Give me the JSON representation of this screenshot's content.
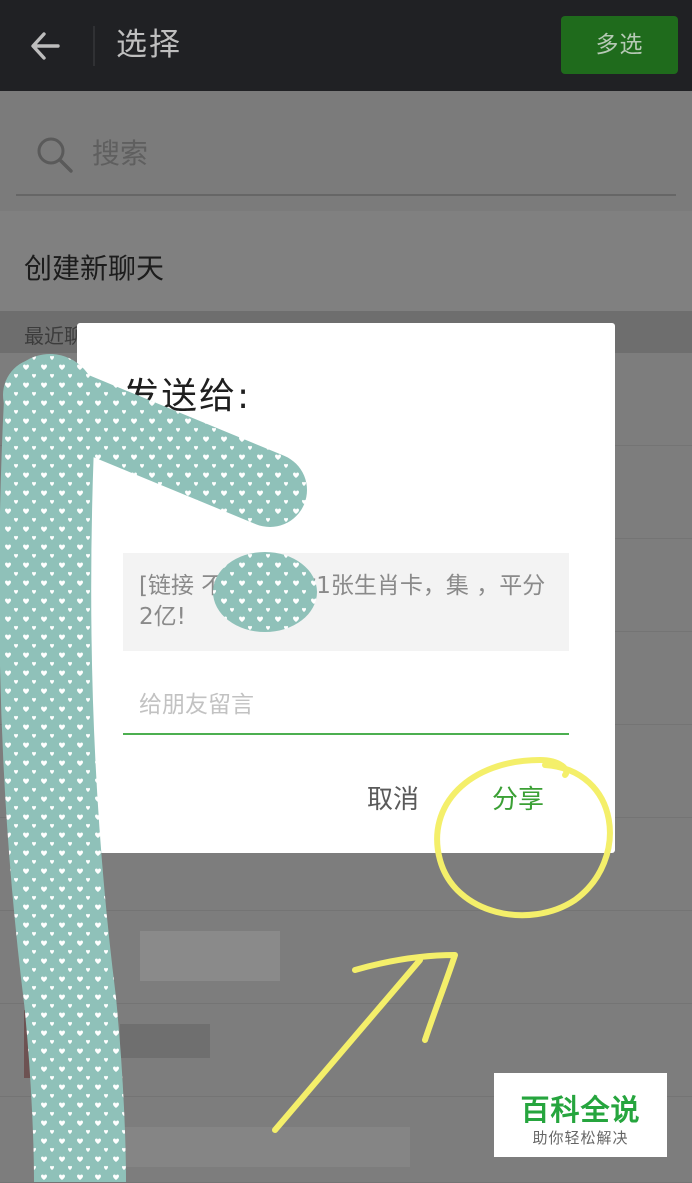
{
  "header": {
    "title": "选择",
    "multi_select_label": "多选"
  },
  "search": {
    "placeholder": "搜索"
  },
  "list": {
    "new_chat_label": "创建新聊天",
    "recent_label": "最近聊"
  },
  "dialog": {
    "title": "发送给:",
    "link_preview_text": "[链接 不相知送你1张生肖卡，集 ，平分2亿!",
    "message_placeholder": "给朋友留言",
    "cancel_label": "取消",
    "share_label": "分享"
  },
  "watermark": {
    "brand": "百科全说",
    "slogan": "助你轻松解决"
  },
  "colors": {
    "topbar": "#202124",
    "accent_green": "#3ba035",
    "annotation_yellow": "#f4ef6a",
    "privacy_pattern": "#8fc1b9"
  },
  "icons": {
    "back": "arrow-left-icon",
    "search": "search-icon"
  }
}
